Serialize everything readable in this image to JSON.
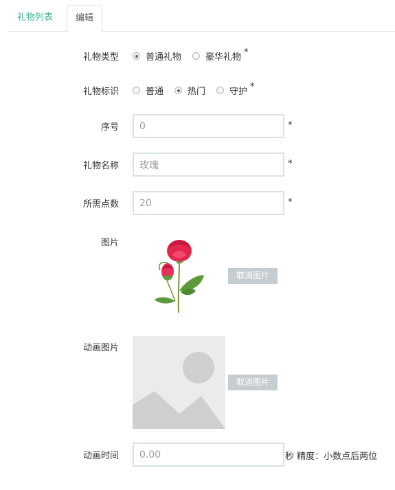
{
  "tabs": {
    "list": "礼物列表",
    "edit": "编辑"
  },
  "form": {
    "gift_type": {
      "label": "礼物类型",
      "options": [
        "普通礼物",
        "豪华礼物"
      ],
      "selected": "普通礼物",
      "required": "*"
    },
    "gift_tag": {
      "label": "礼物标识",
      "options": [
        "普通",
        "热门",
        "守护"
      ],
      "selected": "热门",
      "required": "*"
    },
    "order": {
      "label": "序号",
      "value": "0",
      "required": "*"
    },
    "name": {
      "label": "礼物名称",
      "value": "玫瑰",
      "required": "*"
    },
    "points": {
      "label": "所需点数",
      "value": "20",
      "required": "*"
    },
    "image": {
      "label": "图片",
      "cancel_button": "取消图片"
    },
    "anim_image": {
      "label": "动画图片",
      "cancel_button": "取消图片"
    },
    "anim_time": {
      "label": "动画时间",
      "placeholder": "0.00",
      "suffix": "秒 精度：小数点后两位"
    }
  },
  "colors": {
    "accent": "#3cb78b",
    "button_bg": "#c5cdd1",
    "input_border": "#d7e2e2"
  },
  "icons": {
    "gift_image": "rose-image",
    "anim_placeholder": "image-placeholder-icon"
  }
}
